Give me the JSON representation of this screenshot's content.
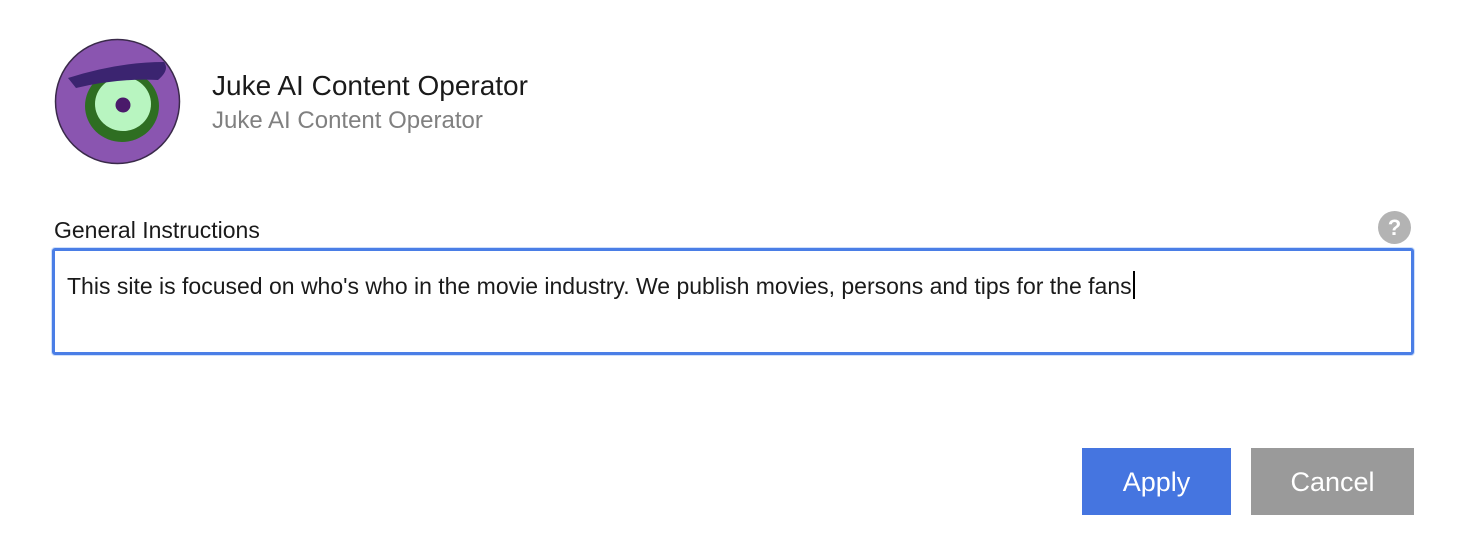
{
  "header": {
    "title": "Juke AI Content Operator",
    "subtitle": "Juke AI Content Operator",
    "avatar_icon": "one-eyed-purple-monster-icon"
  },
  "instructions": {
    "label": "General Instructions",
    "value": "This site is focused on who's who in the movie industry. We publish movies, persons and tips for the fans",
    "help_glyph": "?"
  },
  "actions": {
    "apply_label": "Apply",
    "cancel_label": "Cancel"
  },
  "colors": {
    "accent": "#4575e0",
    "focus_border": "#4a7ee6",
    "cancel_bg": "#9a9a9a",
    "avatar_purple": "#8a55b0",
    "avatar_green": "#2e6e22",
    "avatar_eye": "#b8f5c0"
  }
}
